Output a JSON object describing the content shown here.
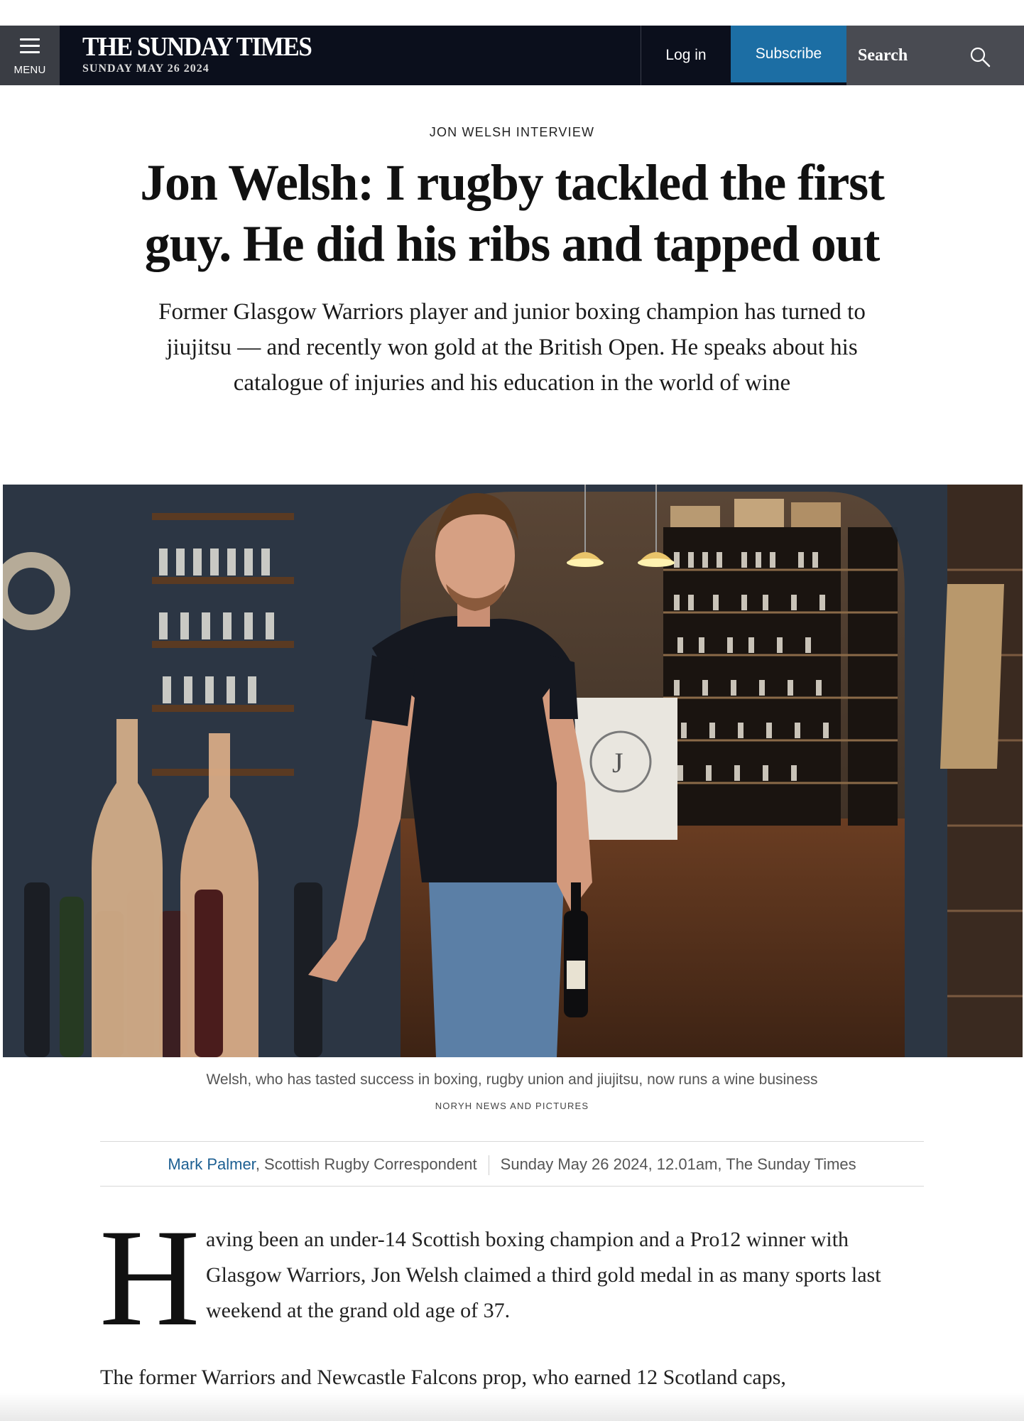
{
  "header": {
    "menu_label": "MENU",
    "masthead": "THE SUNDAY TIMES",
    "dateline": "SUNDAY MAY 26 2024",
    "login_label": "Log in",
    "subscribe_label": "Subscribe",
    "search_label": "Search",
    "subscribe_color": "#1c6ea4",
    "icons": [
      "menu-icon",
      "search-icon"
    ]
  },
  "article": {
    "kicker": "JON WELSH INTERVIEW",
    "headline": "Jon Welsh: I rugby tackled the first guy. He did his ribs and tapped out",
    "standfirst": "Former Glasgow Warriors player and junior boxing champion has turned to jiujitsu — and recently won gold at the British Open. He speaks about his catalogue of injuries and his education in the world of wine",
    "image_caption": "Welsh, who has tasted success in boxing, rugby union and jiujitsu, now runs a wine business",
    "image_credit": "NORYH NEWS AND PICTURES",
    "author": "Mark Palmer",
    "author_role": ", Scottish Rugby Correspondent",
    "published": "Sunday May 26 2024, 12.01am, The Sunday Times",
    "dropcap": "H",
    "paragraph_1": "aving been an under-14 Scottish boxing champion and a Pro12 winner with Glasgow Warriors, Jon Welsh claimed a third gold medal in as many sports last weekend at the grand old age of 37.",
    "paragraph_2": "The former Warriors and Newcastle Falcons prop, who earned 12 Scotland caps,"
  }
}
